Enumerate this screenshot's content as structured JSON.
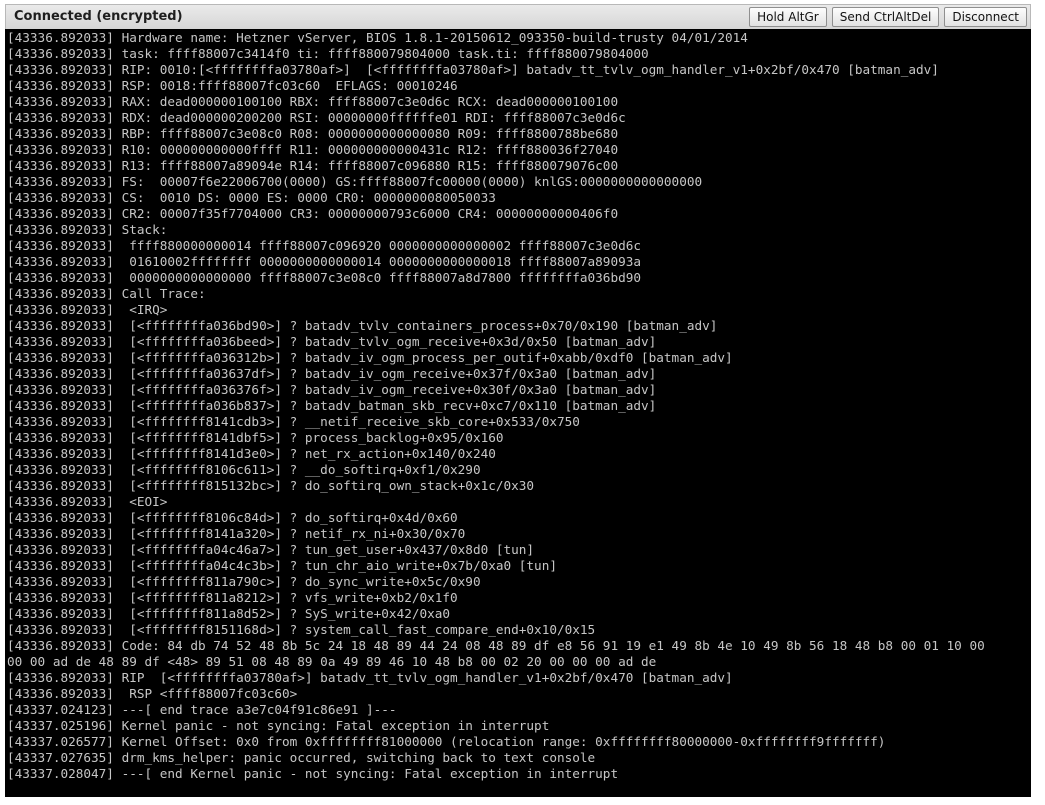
{
  "status_bar": {
    "status_text": "Connected (encrypted)",
    "buttons": {
      "hold_altgr": "Hold AltGr",
      "send_ctrl_alt_del": "Send CtrlAltDel",
      "disconnect": "Disconnect"
    }
  },
  "console": {
    "lines": [
      "[43336.892033] Hardware name: Hetzner vServer, BIOS 1.8.1-20150612_093350-build-trusty 04/01/2014",
      "[43336.892033] task: ffff88007c3414f0 ti: ffff880079804000 task.ti: ffff880079804000",
      "[43336.892033] RIP: 0010:[<ffffffffa03780af>]  [<ffffffffa03780af>] batadv_tt_tvlv_ogm_handler_v1+0x2bf/0x470 [batman_adv]",
      "[43336.892033] RSP: 0018:ffff88007fc03c60  EFLAGS: 00010246",
      "[43336.892033] RAX: dead000000100100 RBX: ffff88007c3e0d6c RCX: dead000000100100",
      "[43336.892033] RDX: dead000000200200 RSI: 00000000ffffffe01 RDI: ffff88007c3e0d6c",
      "[43336.892033] RBP: ffff88007c3e08c0 R08: 0000000000000080 R09: ffff8800788be680",
      "[43336.892033] R10: 000000000000ffff R11: 000000000000431c R12: ffff880036f27040",
      "[43336.892033] R13: ffff88007a89094e R14: ffff88007c096880 R15: ffff880079076c00",
      "[43336.892033] FS:  00007f6e22006700(0000) GS:ffff88007fc00000(0000) knlGS:0000000000000000",
      "[43336.892033] CS:  0010 DS: 0000 ES: 0000 CR0: 0000000080050033",
      "[43336.892033] CR2: 00007f35f7704000 CR3: 00000000793c6000 CR4: 00000000000406f0",
      "[43336.892033] Stack:",
      "[43336.892033]  ffff880000000014 ffff88007c096920 0000000000000002 ffff88007c3e0d6c",
      "[43336.892033]  01610002ffffffff 0000000000000014 0000000000000018 ffff88007a89093a",
      "[43336.892033]  0000000000000000 ffff88007c3e08c0 ffff88007a8d7800 ffffffffa036bd90",
      "[43336.892033] Call Trace:",
      "[43336.892033]  <IRQ>",
      "[43336.892033]  [<ffffffffa036bd90>] ? batadv_tvlv_containers_process+0x70/0x190 [batman_adv]",
      "[43336.892033]  [<ffffffffa036beed>] ? batadv_tvlv_ogm_receive+0x3d/0x50 [batman_adv]",
      "[43336.892033]  [<ffffffffa036312b>] ? batadv_iv_ogm_process_per_outif+0xabb/0xdf0 [batman_adv]",
      "[43336.892033]  [<ffffffffa03637df>] ? batadv_iv_ogm_receive+0x37f/0x3a0 [batman_adv]",
      "[43336.892033]  [<ffffffffa036376f>] ? batadv_iv_ogm_receive+0x30f/0x3a0 [batman_adv]",
      "[43336.892033]  [<ffffffffa036b837>] ? batadv_batman_skb_recv+0xc7/0x110 [batman_adv]",
      "[43336.892033]  [<ffffffff8141cdb3>] ? __netif_receive_skb_core+0x533/0x750",
      "[43336.892033]  [<ffffffff8141dbf5>] ? process_backlog+0x95/0x160",
      "[43336.892033]  [<ffffffff8141d3e0>] ? net_rx_action+0x140/0x240",
      "[43336.892033]  [<ffffffff8106c611>] ? __do_softirq+0xf1/0x290",
      "[43336.892033]  [<ffffffff815132bc>] ? do_softirq_own_stack+0x1c/0x30",
      "[43336.892033]  <EOI>",
      "[43336.892033]  [<ffffffff8106c84d>] ? do_softirq+0x4d/0x60",
      "[43336.892033]  [<ffffffff8141a320>] ? netif_rx_ni+0x30/0x70",
      "[43336.892033]  [<ffffffffa04c46a7>] ? tun_get_user+0x437/0x8d0 [tun]",
      "[43336.892033]  [<ffffffffa04c4c3b>] ? tun_chr_aio_write+0x7b/0xa0 [tun]",
      "[43336.892033]  [<ffffffff811a790c>] ? do_sync_write+0x5c/0x90",
      "[43336.892033]  [<ffffffff811a8212>] ? vfs_write+0xb2/0x1f0",
      "[43336.892033]  [<ffffffff811a8d52>] ? SyS_write+0x42/0xa0",
      "[43336.892033]  [<ffffffff8151168d>] ? system_call_fast_compare_end+0x10/0x15",
      "[43336.892033] Code: 84 db 74 52 48 8b 5c 24 18 48 89 44 24 08 48 89 df e8 56 91 19 e1 49 8b 4e 10 49 8b 56 18 48 b8 00 01 10 00",
      "00 00 ad de 48 89 df <48> 89 51 08 48 89 0a 49 89 46 10 48 b8 00 02 20 00 00 00 ad de",
      "[43336.892033] RIP  [<ffffffffa03780af>] batadv_tt_tvlv_ogm_handler_v1+0x2bf/0x470 [batman_adv]",
      "[43336.892033]  RSP <ffff88007fc03c60>",
      "[43337.024123] ---[ end trace a3e7c04f91c86e91 ]---",
      "[43337.025196] Kernel panic - not syncing: Fatal exception in interrupt",
      "[43337.026577] Kernel Offset: 0x0 from 0xffffffff81000000 (relocation range: 0xffffffff80000000-0xffffffff9fffffff)",
      "[43337.027635] drm_kms_helper: panic occurred, switching back to text console",
      "[43337.028047] ---[ end Kernel panic - not syncing: Fatal exception in interrupt"
    ]
  }
}
